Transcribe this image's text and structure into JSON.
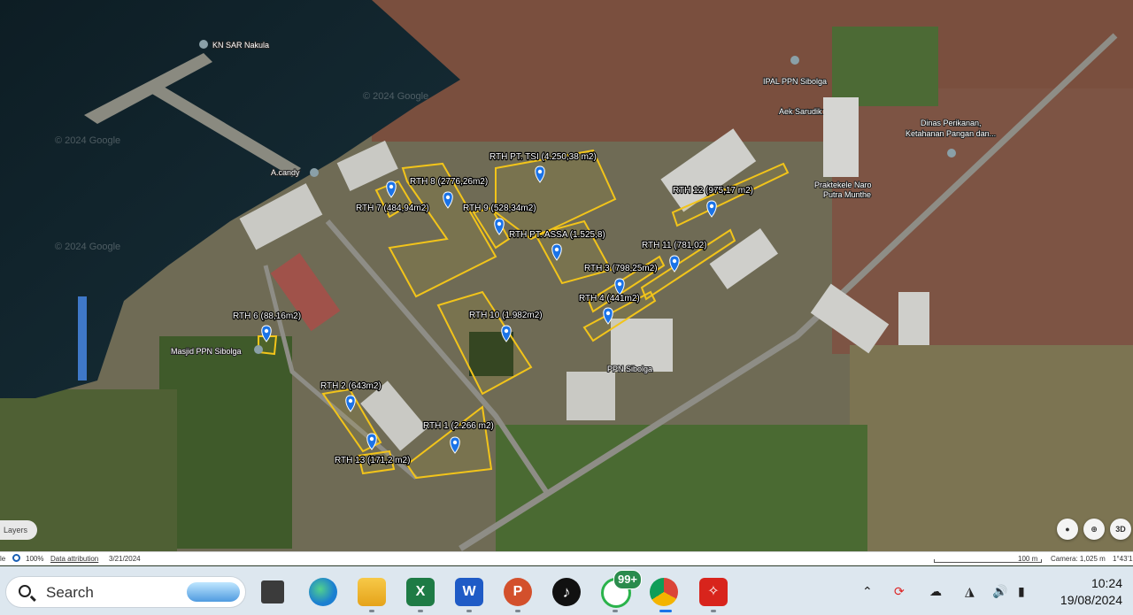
{
  "map": {
    "plot_labels": [
      {
        "id": "rth-pt-tsi",
        "text": "RTH PT. TSI (4.250,38 m2)"
      },
      {
        "id": "rth-8",
        "text": "RTH 8 (2776,26m2)"
      },
      {
        "id": "rth-7",
        "text": "RTH 7 (484,94m2)"
      },
      {
        "id": "rth-9",
        "text": "RTH 9 (528,34m2)"
      },
      {
        "id": "rth-pt-assa",
        "text": "RTH PT. ASSA (1.525,8)"
      },
      {
        "id": "rth-12",
        "text": "RTH 12 (975,17 m2)"
      },
      {
        "id": "rth-11",
        "text": "RTH 11 (781,02)"
      },
      {
        "id": "rth-3",
        "text": "RTH 3 (798,25m2)"
      },
      {
        "id": "rth-4",
        "text": "RTH 4 (441m2)"
      },
      {
        "id": "rth-10",
        "text": "RTH 10 (1.982m2)"
      },
      {
        "id": "rth-6",
        "text": "RTH 6 (88,16m2)"
      },
      {
        "id": "rth-2",
        "text": "RTH 2 (643m2)"
      },
      {
        "id": "rth-1",
        "text": "RTH 1 (2.266 m2)"
      },
      {
        "id": "rth-13",
        "text": "RTH 13 (171,2 m2)"
      }
    ],
    "poi_labels": [
      {
        "id": "kn-sar",
        "text": "KN SAR Nakula"
      },
      {
        "id": "ipal",
        "text": "IPAL PPN Sibolga"
      },
      {
        "id": "aek",
        "text": "Aek Sarudik"
      },
      {
        "id": "dinas",
        "text": "Dinas Perikanan,"
      },
      {
        "id": "dinas2",
        "text": "Ketahanan Pangan dan..."
      },
      {
        "id": "pratekele",
        "text": "Praktekele Naro"
      },
      {
        "id": "putra",
        "text": "Putra Munthe"
      },
      {
        "id": "acandy",
        "text": "A.candy"
      },
      {
        "id": "masjid",
        "text": "Masjid PPN Sibolga"
      },
      {
        "id": "ppn",
        "text": "PPN Sibolga"
      }
    ],
    "watermark": "© 2024 Google",
    "controls": {
      "layers": "Layers",
      "view3d": "3D"
    },
    "status": {
      "zoom": "100%",
      "attribution": "Data attribution",
      "date": "3/21/2024",
      "scale": "100 m",
      "camera": "Camera: 1,025 m",
      "coords": "1°43'1"
    },
    "colors": {
      "outline": "#f2c41a",
      "pin": "#1a73e8"
    }
  },
  "taskbar": {
    "search_label": "Search",
    "apps": [
      {
        "name": "file-manager-icon"
      },
      {
        "name": "edge-icon"
      },
      {
        "name": "file-explorer-icon"
      },
      {
        "name": "excel-icon"
      },
      {
        "name": "word-icon"
      },
      {
        "name": "powerpoint-icon"
      },
      {
        "name": "tiktok-icon"
      },
      {
        "name": "whatsapp-icon",
        "badge": "99+"
      },
      {
        "name": "chrome-icon"
      },
      {
        "name": "acrobat-icon"
      }
    ],
    "time": "10:24",
    "date": "19/08/2024"
  }
}
